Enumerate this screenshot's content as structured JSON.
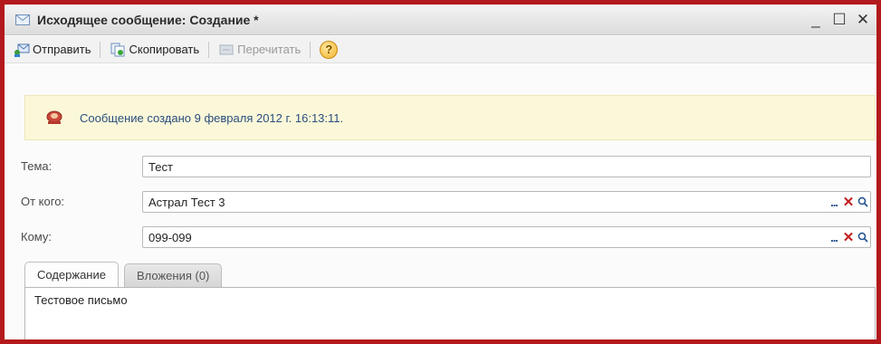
{
  "window": {
    "title": "Исходящее сообщение: Создание *",
    "icon": "envelope-icon",
    "controls": [
      "_",
      "☐",
      "✕"
    ]
  },
  "toolbar": {
    "send_label": "Отправить",
    "copy_label": "Скопировать",
    "reread_label": "Перечитать",
    "help_label": "?"
  },
  "info": {
    "icon": "info-stamp-icon",
    "message": "Сообщение создано 9 февраля 2012 г. 16:13:11."
  },
  "form": {
    "subject": {
      "label": "Тема:",
      "value": "Тест"
    },
    "from": {
      "label": "От кого:",
      "value": "Астрал Тест 3"
    },
    "to": {
      "label": "Кому:",
      "value": "099-099"
    },
    "choose_glyph": "...",
    "clear_glyph": "✕",
    "open_glyph": "Q"
  },
  "tabs": [
    {
      "label": "Содержание",
      "active": true
    },
    {
      "label": "Вложения (0)",
      "active": false
    }
  ],
  "body_text": "Тестовое письмо",
  "colors": {
    "frame": "#b3191c",
    "info_bg": "#fbf8d9",
    "info_text": "#2a4e7f",
    "clear_action": "#c21d1d",
    "action_blue": "#1e4e8c"
  }
}
